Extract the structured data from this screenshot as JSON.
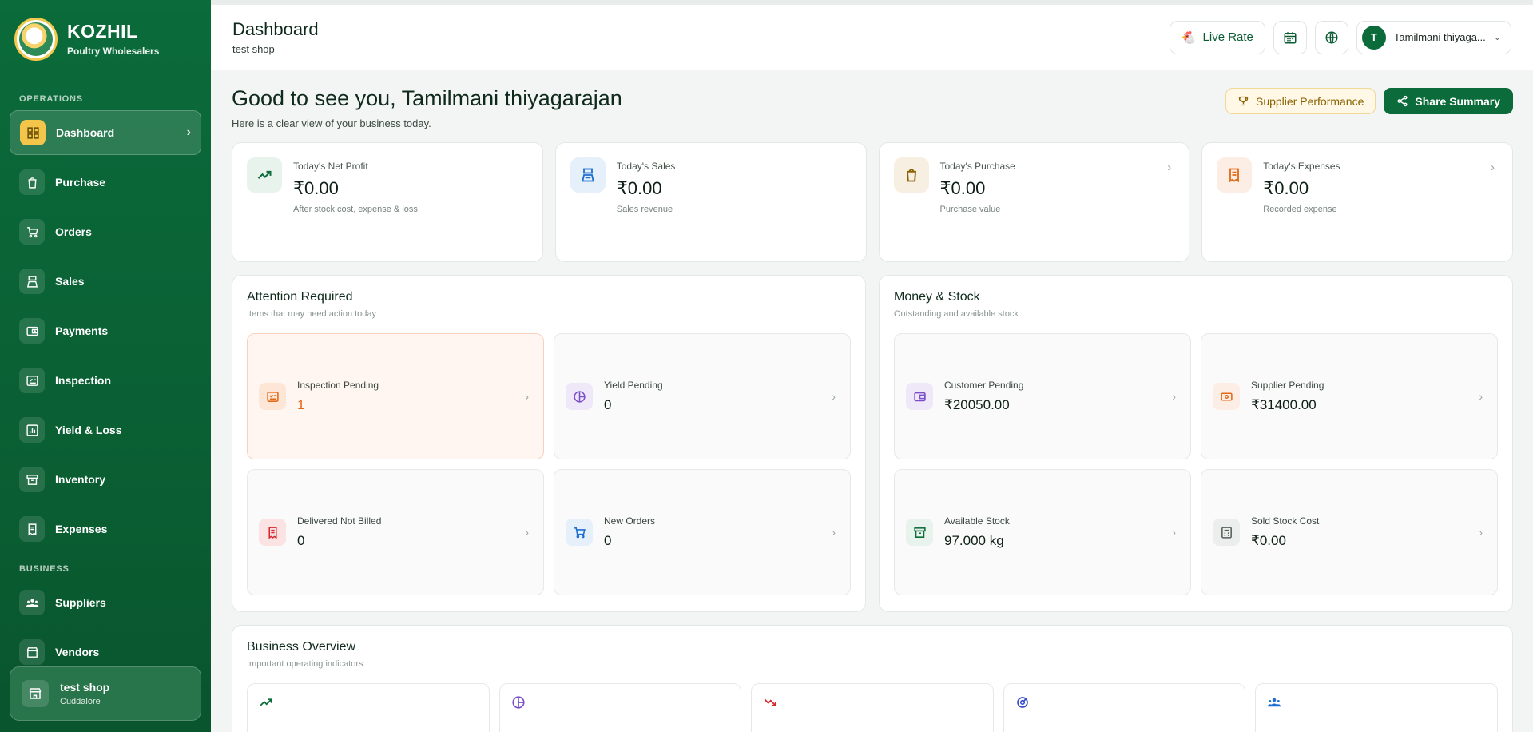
{
  "brand": {
    "name": "KOZHIL",
    "tagline": "Poultry Wholesalers"
  },
  "sidebar": {
    "operations_label": "OPERATIONS",
    "business_label": "BUSINESS",
    "operations": [
      {
        "label": "Dashboard",
        "icon": "dashboard-icon",
        "active": true
      },
      {
        "label": "Purchase",
        "icon": "shopping-bag-icon"
      },
      {
        "label": "Orders",
        "icon": "cart-icon"
      },
      {
        "label": "Sales",
        "icon": "scale-icon"
      },
      {
        "label": "Payments",
        "icon": "wallet-icon"
      },
      {
        "label": "Inspection",
        "icon": "checklist-icon"
      },
      {
        "label": "Yield & Loss",
        "icon": "bar-chart-icon"
      },
      {
        "label": "Inventory",
        "icon": "archive-icon"
      },
      {
        "label": "Expenses",
        "icon": "receipt-icon"
      }
    ],
    "business": [
      {
        "label": "Suppliers",
        "icon": "users-icon"
      },
      {
        "label": "Vendors",
        "icon": "store-icon"
      }
    ],
    "shop": {
      "name": "test shop",
      "location": "Cuddalore"
    }
  },
  "header": {
    "title": "Dashboard",
    "subtitle": "test shop",
    "live_rate": "Live Rate",
    "user_initial": "T",
    "user_name": "Tamilmani thiyaga..."
  },
  "welcome": {
    "greeting": "Good to see you, Tamilmani thiyagarajan",
    "sub": "Here is a clear view of your business today.",
    "supplier_btn": "Supplier Performance",
    "share_btn": "Share Summary"
  },
  "kpis": [
    {
      "label": "Today's Net Profit",
      "value": "₹0.00",
      "note": "After stock cost, expense & loss",
      "icon": "trend-up-icon",
      "color": "#e7f3ec",
      "fg": "#0b6b3a",
      "chevron": false
    },
    {
      "label": "Today's Sales",
      "value": "₹0.00",
      "note": "Sales revenue",
      "icon": "scale-icon",
      "color": "#e6f0fb",
      "fg": "#1e6fd0",
      "chevron": false
    },
    {
      "label": "Today's Purchase",
      "value": "₹0.00",
      "note": "Purchase value",
      "icon": "shopping-bag-icon",
      "color": "#f7efe1",
      "fg": "#8a6200",
      "chevron": true
    },
    {
      "label": "Today's Expenses",
      "value": "₹0.00",
      "note": "Recorded expense",
      "icon": "receipt-icon",
      "color": "#fdeee5",
      "fg": "#e26a15",
      "chevron": true
    }
  ],
  "attention": {
    "title": "Attention Required",
    "sub": "Items that may need action today",
    "tiles": [
      {
        "label": "Inspection Pending",
        "value": "1",
        "icon": "checklist-icon",
        "alert": true
      },
      {
        "label": "Yield Pending",
        "value": "0",
        "icon": "pie-icon"
      },
      {
        "label": "Delivered Not Billed",
        "value": "0",
        "icon": "receipt-icon"
      },
      {
        "label": "New Orders",
        "value": "0",
        "icon": "cart-icon"
      }
    ]
  },
  "money": {
    "title": "Money & Stock",
    "sub": "Outstanding and available stock",
    "tiles": [
      {
        "label": "Customer Pending",
        "value": "₹20050.00",
        "icon": "wallet-icon"
      },
      {
        "label": "Supplier Pending",
        "value": "₹31400.00",
        "icon": "cash-icon"
      },
      {
        "label": "Available Stock",
        "value": "97.000 kg",
        "icon": "archive-icon"
      },
      {
        "label": "Sold Stock Cost",
        "value": "₹0.00",
        "icon": "calculator-icon"
      }
    ]
  },
  "overview": {
    "title": "Business Overview",
    "sub": "Important operating indicators",
    "cards": [
      {
        "icon": "trend-up-icon",
        "color": "#0b6b3a"
      },
      {
        "icon": "pie-icon",
        "color": "#7b4fc9"
      },
      {
        "icon": "trend-down-icon",
        "color": "#d9262b"
      },
      {
        "icon": "target-icon",
        "color": "#3b4fc9"
      },
      {
        "icon": "users-icon",
        "color": "#1e6fd0"
      }
    ]
  }
}
